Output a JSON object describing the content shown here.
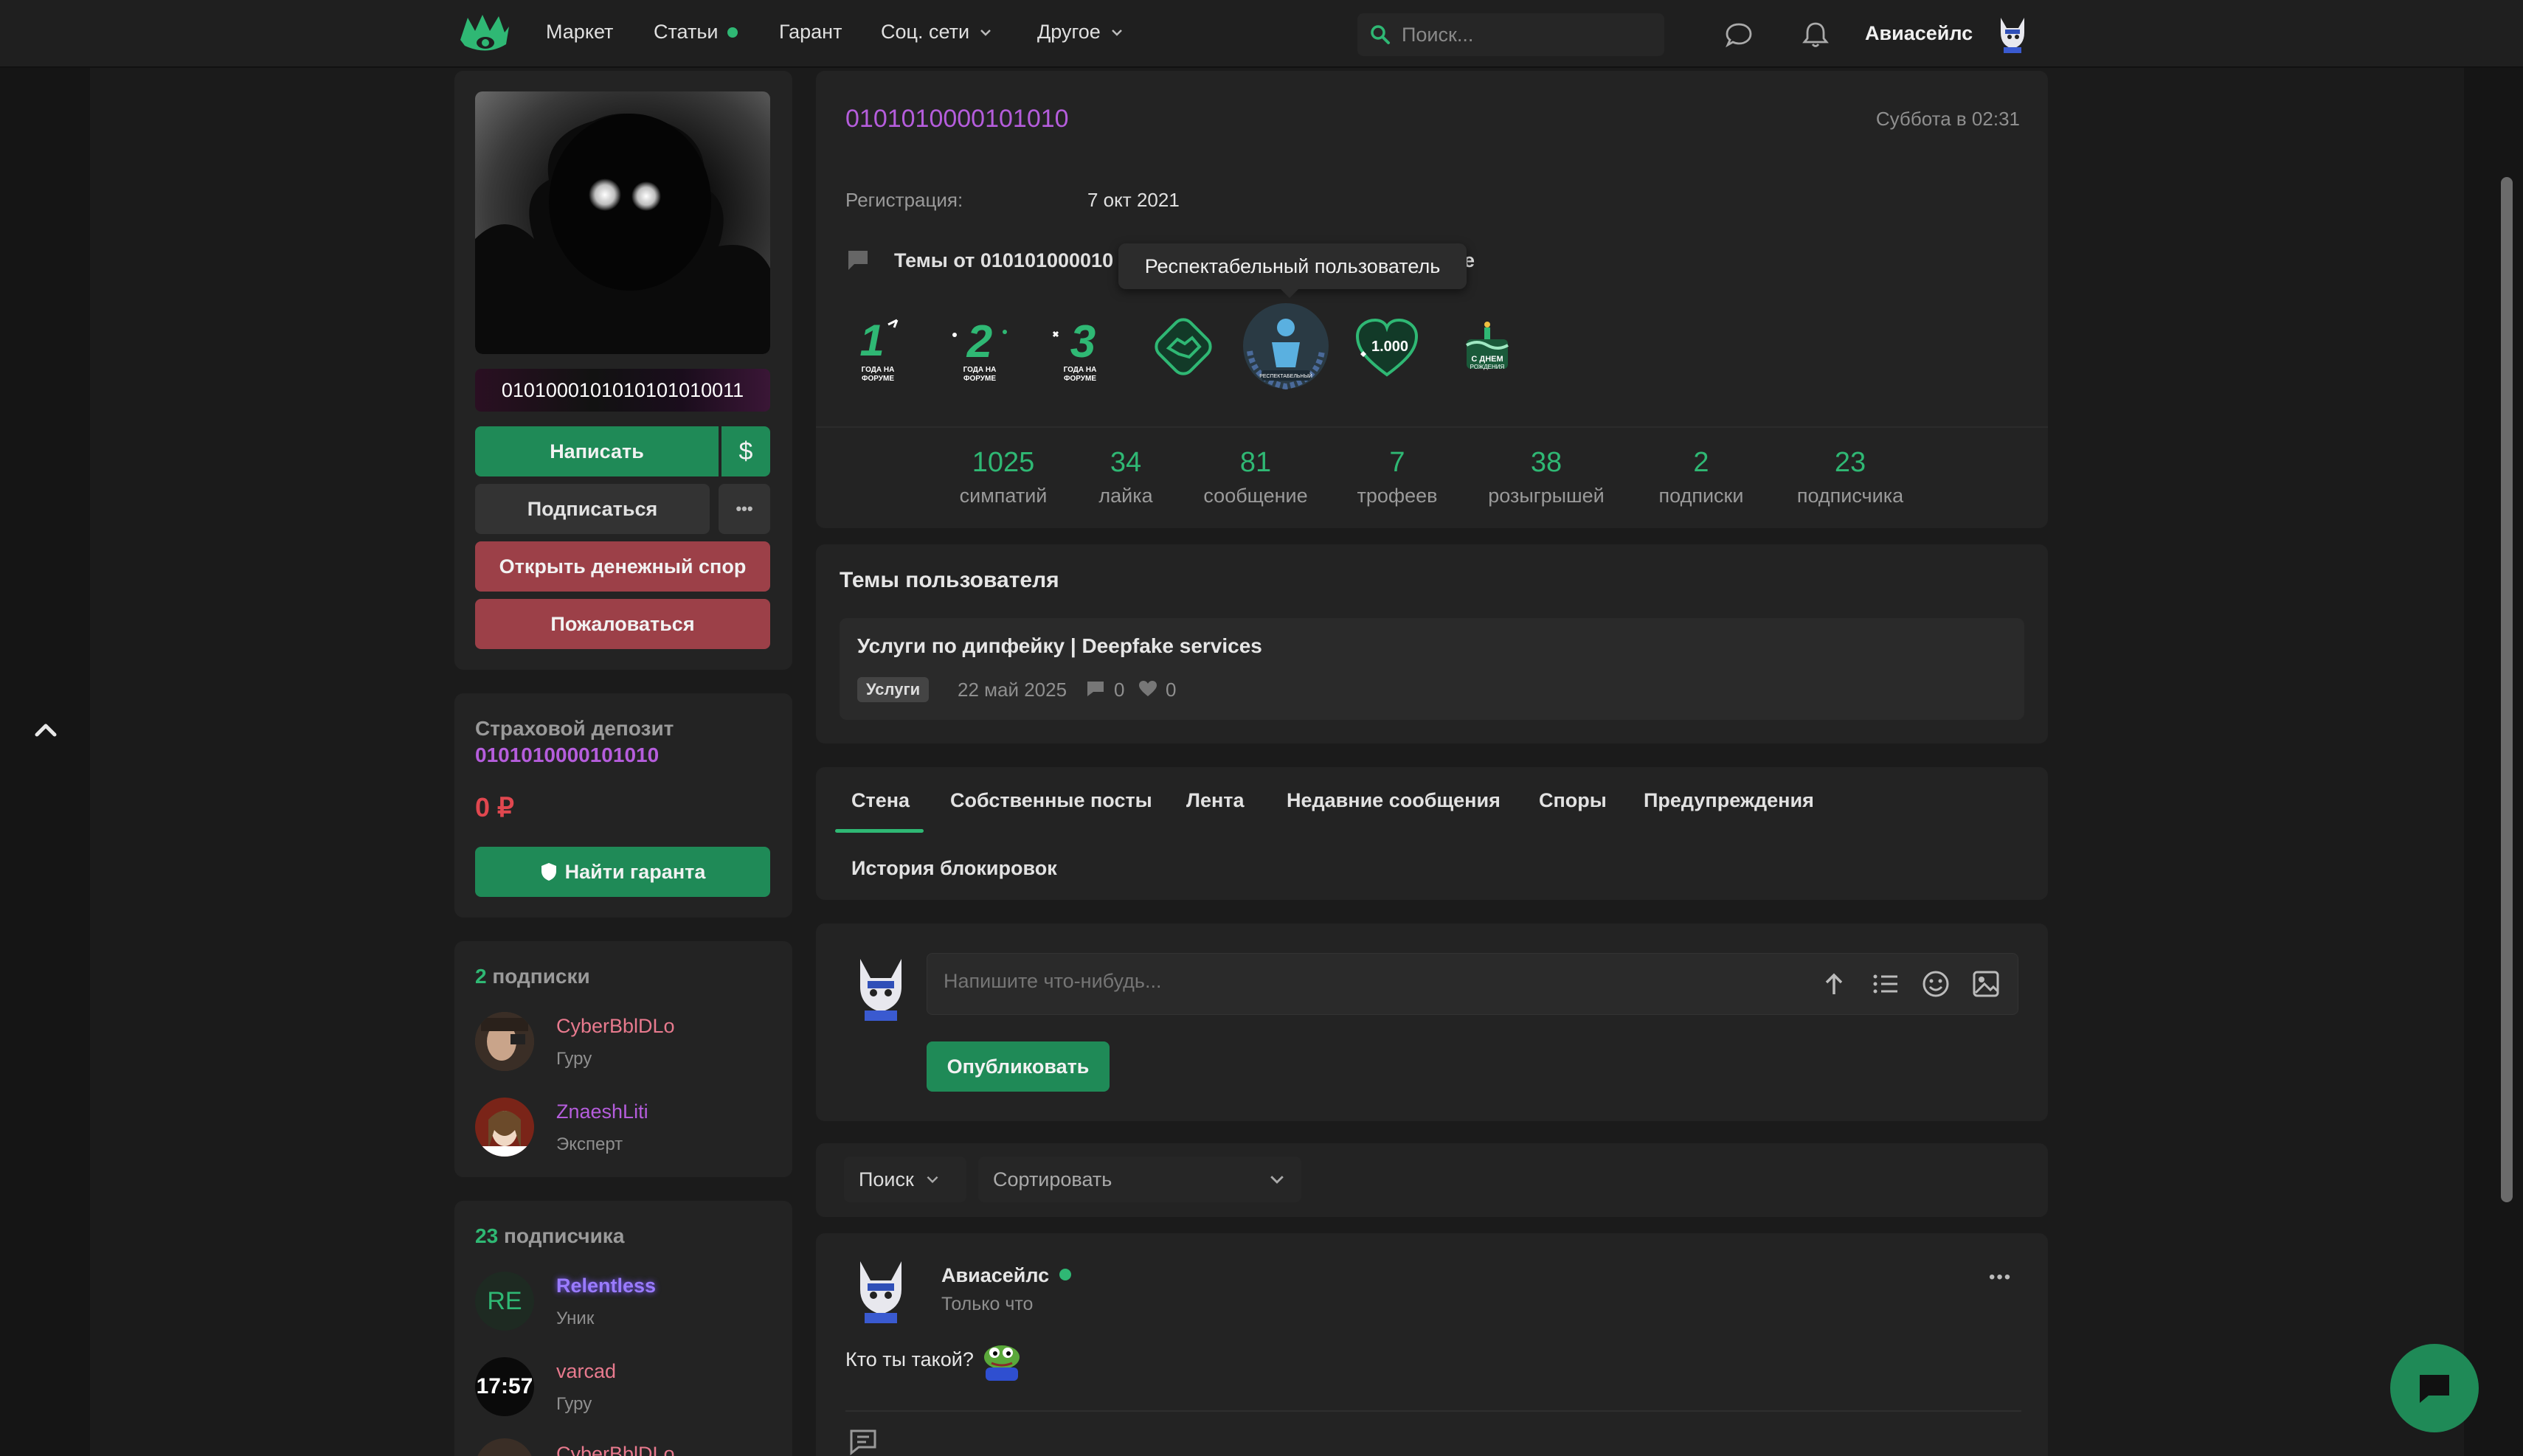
{
  "nav": {
    "market": "Маркет",
    "articles": "Статьи",
    "guarantor": "Гарант",
    "social": "Соц. сети",
    "other": "Другое",
    "search_placeholder": "Поиск...",
    "username": "Авиасейлс"
  },
  "profile": {
    "nickname": "0101000101010101010011",
    "write_btn": "Написать",
    "money_btn": "$",
    "subscribe_btn": "Подписаться",
    "more_btn": "•••",
    "dispute_btn": "Открыть денежный спор",
    "report_btn": "Пожаловаться"
  },
  "deposit": {
    "title": "Страховой депозит",
    "user": "0101010000101010",
    "amount": "0 ₽",
    "find_btn": "Найти гаранта"
  },
  "subscriptions": {
    "count": "2",
    "label": "подписки",
    "items": [
      {
        "name": "CyberBblDLo",
        "rank": "Гуру",
        "color": "#e87a8e"
      },
      {
        "name": "ZnaeshLiti",
        "rank": "Эксперт",
        "color": "#b55ddc"
      }
    ]
  },
  "subscribers": {
    "count": "23",
    "label": "подписчика",
    "items": [
      {
        "name": "Relentless",
        "rank": "Уник",
        "avatar_text": "RE",
        "color": "#9a7bff"
      },
      {
        "name": "varcad",
        "rank": "Гуру",
        "avatar_text": "17:57",
        "color": "#e87a8e"
      },
      {
        "name": "CyberBblDLo",
        "rank": "",
        "avatar_text": "",
        "color": "#e87a8e"
      }
    ]
  },
  "header": {
    "username": "0101010000101010",
    "last_seen": "Суббота в 02:31",
    "reg_label": "Регистрация:",
    "reg_date": "7 окт 2021",
    "topics_label": "Темы от 010101000010",
    "topics_tail": "е",
    "tooltip": "Респектабельный пользователь"
  },
  "badges": [
    {
      "name": "year-1-badge",
      "num": "1",
      "text": "ГОДА НА ФОРУМЕ"
    },
    {
      "name": "year-2-badge",
      "num": "2",
      "text": "ГОДА НА ФОРУМЕ"
    },
    {
      "name": "year-3-badge",
      "num": "3",
      "text": "ГОДА НА ФОРУМЕ"
    },
    {
      "name": "handshake-badge",
      "num": "",
      "text": ""
    },
    {
      "name": "respectable-user-badge",
      "num": "",
      "text": "РЕСПЕКТАБЕЛЬНЫЙ ПОЛЬЗОВАТЕЛЬ"
    },
    {
      "name": "likes-1000-badge",
      "num": "1.000",
      "text": ""
    },
    {
      "name": "birthday-badge",
      "num": "",
      "text": "С ДНЕМ РОЖДЕНИЯ"
    }
  ],
  "stats": [
    {
      "value": "1025",
      "label": "симпатий"
    },
    {
      "value": "34",
      "label": "лайка"
    },
    {
      "value": "81",
      "label": "сообщение"
    },
    {
      "value": "7",
      "label": "трофеев"
    },
    {
      "value": "38",
      "label": "розыгрышей"
    },
    {
      "value": "2",
      "label": "подписки"
    },
    {
      "value": "23",
      "label": "подписчика"
    }
  ],
  "user_topics": {
    "title": "Темы пользователя",
    "topic_title": "Услуги по дипфейку | Deepfake services",
    "tag": "Услуги",
    "date": "22 май 2025",
    "comments": "0",
    "likes": "0"
  },
  "tabs": [
    "Стена",
    "Собственные посты",
    "Лента",
    "Недавние сообщения",
    "Споры",
    "Предупреждения",
    "История блокировок"
  ],
  "composer": {
    "placeholder": "Напишите что-нибудь...",
    "publish": "Опубликовать"
  },
  "filters": {
    "search": "Поиск",
    "sort": "Сортировать"
  },
  "post": {
    "author": "Авиасейлс",
    "time": "Только что",
    "text": "Кто ты такой?",
    "more": "•••"
  },
  "colors": {
    "accent_green": "#2fb874",
    "button_green": "#1f8a57",
    "danger_red": "#9c4048",
    "purple_nick": "#b55ddc",
    "panel": "#232323"
  }
}
